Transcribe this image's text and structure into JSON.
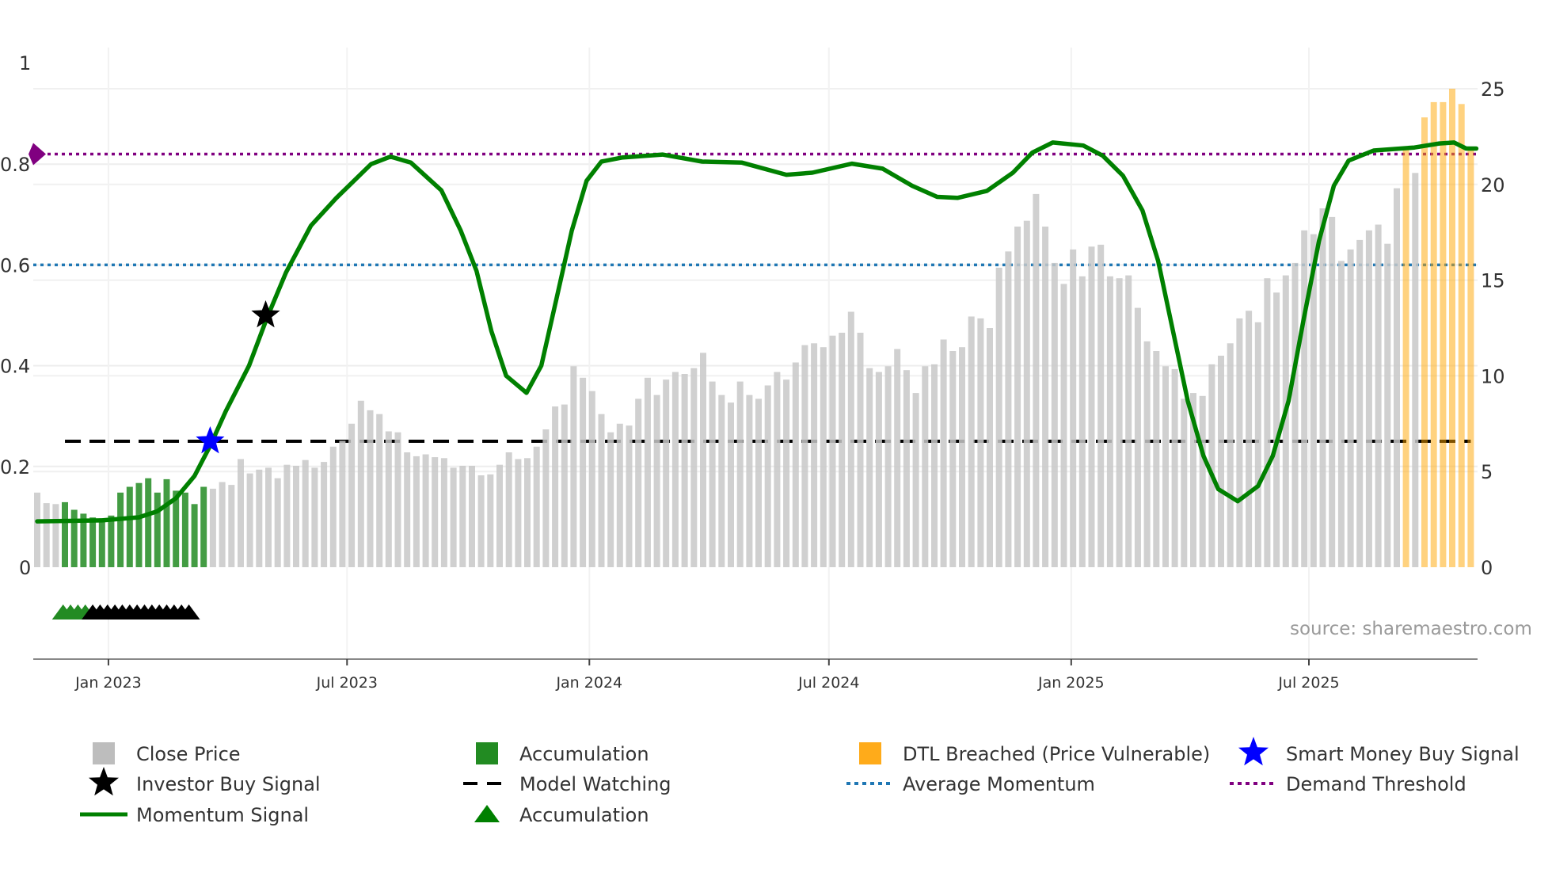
{
  "chart_data": {
    "type": "bar",
    "title": "",
    "xlabel": "",
    "ylabel_left": "",
    "ylabel_right": "",
    "ylim_left": [
      0,
      1
    ],
    "ylim_right": [
      0,
      25
    ],
    "grid": true,
    "left_ticks": [
      "0",
      "0.2",
      "0.4",
      "0.6",
      "0.8",
      "1"
    ],
    "left_tick_values": [
      0,
      0.2,
      0.4,
      0.6,
      0.8,
      1
    ],
    "right_ticks": [
      "0",
      "5",
      "10",
      "15",
      "20",
      "25"
    ],
    "right_tick_values": [
      0,
      5,
      10,
      15,
      20,
      25
    ],
    "x_ticks": [
      {
        "label": "Jan 2023",
        "week": 7.7
      },
      {
        "label": "Jul 2023",
        "week": 33.5
      },
      {
        "label": "Jan 2024",
        "week": 59.7
      },
      {
        "label": "Jul 2024",
        "week": 85.6
      },
      {
        "label": "Jan 2025",
        "week": 111.8
      },
      {
        "label": "Jul 2025",
        "week": 137.5
      }
    ],
    "close_price": [
      3.9,
      3.35,
      3.3,
      3.4,
      3.0,
      2.8,
      2.6,
      2.55,
      2.7,
      3.9,
      4.2,
      4.4,
      4.65,
      3.9,
      4.6,
      4.0,
      3.9,
      3.3,
      4.2,
      4.1,
      4.45,
      4.3,
      5.65,
      4.9,
      5.1,
      5.2,
      4.65,
      5.35,
      5.3,
      5.6,
      5.2,
      5.5,
      6.3,
      6.6,
      7.5,
      8.7,
      8.2,
      8.0,
      7.1,
      7.05,
      6.0,
      5.8,
      5.9,
      5.75,
      5.7,
      5.2,
      5.3,
      5.3,
      4.8,
      4.85,
      5.35,
      6.0,
      5.65,
      5.7,
      6.3,
      7.2,
      8.4,
      8.5,
      10.5,
      9.9,
      9.2,
      8.0,
      7.05,
      7.5,
      7.4,
      8.8,
      9.9,
      9.0,
      9.8,
      10.2,
      10.1,
      10.4,
      11.2,
      9.7,
      9.0,
      8.6,
      9.7,
      9.0,
      8.8,
      9.5,
      10.2,
      9.8,
      10.7,
      11.6,
      11.7,
      11.5,
      12.1,
      12.25,
      13.35,
      12.25,
      10.4,
      10.2,
      10.5,
      11.4,
      10.3,
      9.1,
      10.5,
      10.6,
      11.9,
      11.3,
      11.5,
      13.1,
      13.0,
      12.5,
      15.65,
      16.5,
      17.8,
      18.1,
      19.5,
      17.8,
      15.9,
      14.8,
      16.6,
      15.2,
      16.75,
      16.85,
      15.2,
      15.1,
      15.25,
      13.55,
      11.8,
      11.3,
      10.5,
      10.35,
      8.8,
      9.1,
      8.95,
      10.6,
      11.05,
      11.7,
      13.0,
      13.4,
      12.8,
      15.1,
      14.35,
      15.25,
      15.9,
      17.6,
      17.4,
      18.75,
      18.3,
      16.0,
      16.6,
      17.1,
      17.6,
      17.9,
      16.9,
      19.8,
      21.9,
      20.6,
      23.5,
      24.3,
      24.3,
      25.0,
      24.2,
      21.9
    ],
    "accumulation_bar_indices": [
      3,
      4,
      5,
      6,
      7,
      8,
      9,
      10,
      11,
      12,
      13,
      14,
      15,
      16,
      17,
      18
    ],
    "dtl_breached_bar_indices": [
      148,
      150,
      151,
      152,
      153,
      154,
      155
    ],
    "momentum_signal": [
      [
        0,
        0.091
      ],
      [
        7,
        0.093
      ],
      [
        11,
        0.099
      ],
      [
        13,
        0.111
      ],
      [
        15,
        0.137
      ],
      [
        17,
        0.181
      ],
      [
        18.7,
        0.241
      ],
      [
        20.4,
        0.31
      ],
      [
        22.9,
        0.4
      ],
      [
        24.8,
        0.493
      ],
      [
        26.9,
        0.585
      ],
      [
        29.6,
        0.678
      ],
      [
        32.3,
        0.732
      ],
      [
        36.1,
        0.8
      ],
      [
        38.2,
        0.815
      ],
      [
        40.4,
        0.803
      ],
      [
        43.7,
        0.748
      ],
      [
        45.8,
        0.668
      ],
      [
        47.5,
        0.588
      ],
      [
        49.1,
        0.469
      ],
      [
        50.7,
        0.38
      ],
      [
        52.9,
        0.346
      ],
      [
        54.5,
        0.4
      ],
      [
        56.1,
        0.529
      ],
      [
        57.8,
        0.668
      ],
      [
        59.4,
        0.767
      ],
      [
        61.0,
        0.805
      ],
      [
        63.2,
        0.813
      ],
      [
        67.6,
        0.819
      ],
      [
        71.9,
        0.805
      ],
      [
        76.2,
        0.803
      ],
      [
        81.0,
        0.779
      ],
      [
        83.8,
        0.783
      ],
      [
        88.1,
        0.801
      ],
      [
        91.4,
        0.791
      ],
      [
        94.6,
        0.757
      ],
      [
        97.3,
        0.735
      ],
      [
        99.5,
        0.733
      ],
      [
        102.7,
        0.747
      ],
      [
        105.5,
        0.783
      ],
      [
        107.6,
        0.823
      ],
      [
        109.8,
        0.843
      ],
      [
        113.1,
        0.837
      ],
      [
        115.2,
        0.817
      ],
      [
        117.4,
        0.777
      ],
      [
        119.5,
        0.708
      ],
      [
        121.2,
        0.608
      ],
      [
        122.8,
        0.469
      ],
      [
        124.4,
        0.33
      ],
      [
        126.1,
        0.221
      ],
      [
        127.7,
        0.155
      ],
      [
        129.8,
        0.131
      ],
      [
        132.0,
        0.161
      ],
      [
        133.6,
        0.221
      ],
      [
        135.3,
        0.33
      ],
      [
        136.9,
        0.489
      ],
      [
        138.6,
        0.648
      ],
      [
        140.2,
        0.757
      ],
      [
        141.8,
        0.807
      ],
      [
        144.5,
        0.827
      ],
      [
        148.9,
        0.833
      ],
      [
        151.6,
        0.841
      ],
      [
        153.2,
        0.843
      ],
      [
        154.5,
        0.831
      ],
      [
        155.6,
        0.831
      ]
    ],
    "demand_threshold": 0.82,
    "average_momentum": 0.6,
    "model_watching": {
      "value": 0.25,
      "start_week": 3,
      "end_week": 155
    },
    "smart_money_buy_signal": {
      "week": 18.7,
      "value": 0.25
    },
    "investor_buy_signal": {
      "week": 24.7,
      "value": 0.5
    },
    "accumulation_triangles": {
      "start_week": 2.8,
      "step_weeks": 0.8,
      "green_count": 4,
      "black_count": 14
    },
    "colors": {
      "close_price": "#c8c8c8",
      "accumulation": "#228b22",
      "dtl": "#ffa500",
      "momentum": "#008000",
      "average_momentum": "#1f77b4",
      "demand_threshold": "#800080",
      "smart_money": "#0000ff",
      "investor": "#000000"
    },
    "legend": {
      "placement": "bottom",
      "items": [
        {
          "label": "Close Price",
          "icon": "gray-square-icon"
        },
        {
          "label": "Accumulation",
          "icon": "green-square-icon"
        },
        {
          "label": "DTL Breached (Price Vulnerable)",
          "icon": "orange-square-icon"
        },
        {
          "label": "Smart Money Buy Signal",
          "icon": "blue-star-icon"
        },
        {
          "label": "Investor Buy Signal",
          "icon": "black-star-icon"
        },
        {
          "label": "Model Watching",
          "icon": "dashed-line-icon"
        },
        {
          "label": "Average Momentum",
          "icon": "blue-dotted-line-icon"
        },
        {
          "label": "Demand Threshold",
          "icon": "purple-dotted-line-icon"
        },
        {
          "label": "Momentum Signal",
          "icon": "green-line-icon"
        },
        {
          "label": "Accumulation",
          "icon": "green-triangle-icon"
        }
      ]
    },
    "source": "source: sharemaestro.com"
  }
}
